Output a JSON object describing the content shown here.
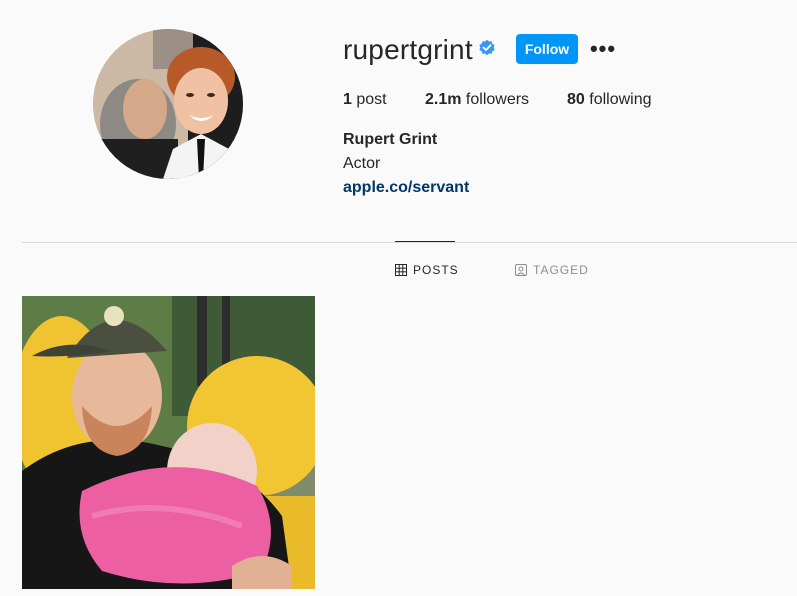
{
  "profile": {
    "username": "rupertgrint",
    "verified_icon": "verified-badge-icon",
    "follow_label": "Follow",
    "more_icon": "more-options-icon",
    "more_label": "•••",
    "accent": "#0095f6"
  },
  "stats": {
    "posts_count": "1",
    "posts_label": "post",
    "followers_count": "2.1m",
    "followers_label": "followers",
    "following_count": "80",
    "following_label": "following"
  },
  "bio": {
    "full_name": "Rupert Grint",
    "description": "Actor",
    "link": "apple.co/servant",
    "link_color": "#00376b"
  },
  "tabs": [
    {
      "label": "POSTS",
      "icon": "grid-icon",
      "active": true
    },
    {
      "label": "TAGGED",
      "icon": "tagged-icon",
      "active": false
    }
  ],
  "posts": [
    {
      "image": "post-photo"
    }
  ]
}
